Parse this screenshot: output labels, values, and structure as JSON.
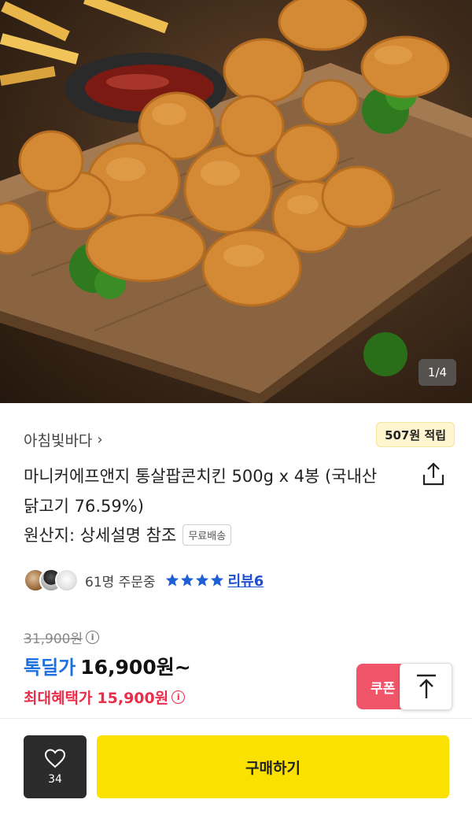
{
  "hero": {
    "alt": "popcorn chicken on wooden board",
    "counter": "1/4"
  },
  "seller": {
    "brand": "아침빛바다",
    "chevron_icon": "chevron-right-icon"
  },
  "reward": {
    "label": "507원 적립"
  },
  "product": {
    "title": "마니커에프앤지 통살팝콘치킨 500g x 4봉 (국내산 닭고기 76.59%)",
    "origin": "원산지: 상세설명 참조",
    "shipping_badge": "무료배송"
  },
  "social": {
    "orders": "61명 주문중",
    "rating_stars": 4,
    "reviews_label": "리뷰6"
  },
  "price": {
    "original": "31,900원",
    "deal_label": "톡딜가",
    "deal_price": "16,900원~",
    "max_benefit_label": "최대혜택가",
    "max_benefit_price": "15,900원",
    "info_icon": "ⓘ"
  },
  "coupon": {
    "label": "쿠폰"
  },
  "bottom": {
    "like_count": "34",
    "buy_label": "구매하기"
  },
  "colors": {
    "deal_blue": "#1c6fe0",
    "benefit_red": "#ea2e4a",
    "buy_yellow": "#fae100",
    "coupon_pink": "#f0556a",
    "star_blue": "#1f5fd6"
  }
}
